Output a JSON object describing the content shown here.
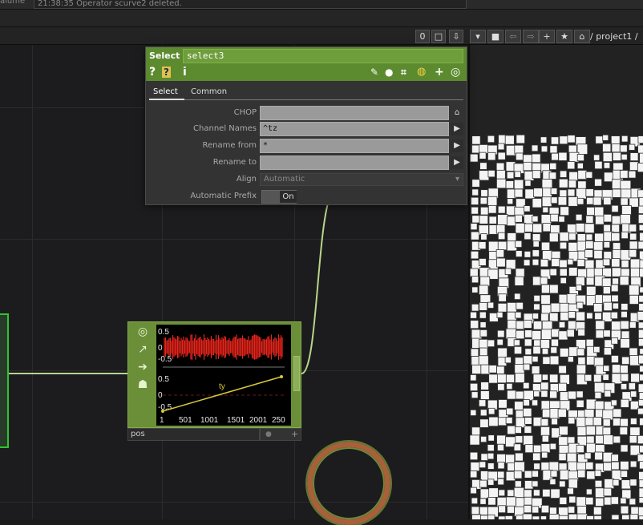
{
  "status_bar": {
    "label": "alume",
    "message": "21:38:35 Operator scurve2 deleted."
  },
  "toolbar": {
    "buttons": [
      "0",
      "□",
      "⇩",
      "▾",
      "■",
      "⇦",
      "⇨",
      "+",
      "★",
      "⌂"
    ],
    "path": "/ project1 /"
  },
  "parameter_panel": {
    "op_type": "Select",
    "op_name": "select3",
    "header_icons": [
      "help-icon",
      "python-help-icon",
      "info-icon",
      "edit-icon",
      "comment-icon",
      "clone-icon",
      "python-icon",
      "add-icon",
      "target-icon"
    ],
    "tabs": [
      {
        "label": "Select",
        "selected": true
      },
      {
        "label": "Common",
        "selected": false
      }
    ],
    "params": [
      {
        "label": "CHOP",
        "value": ""
      },
      {
        "label": "Channel Names",
        "value": "^tz"
      },
      {
        "label": "Rename from",
        "value": "*"
      },
      {
        "label": "Rename to",
        "value": ""
      },
      {
        "label": "Align",
        "value": "Automatic"
      },
      {
        "label": "Automatic Prefix",
        "value": "On"
      }
    ],
    "accent_color": "#5c8a2f"
  },
  "node_pos": {
    "name": "pos",
    "color": "#6a8f38",
    "flag_icons": [
      "viewer-icon",
      "bypass-icon",
      "display-icon",
      "lock-icon"
    ],
    "preview": {
      "top_ticks": [
        "0.5",
        "0",
        "-0.5"
      ],
      "bottom_ticks": [
        "0.5",
        "0",
        "-0.5"
      ],
      "x_ticks": [
        "1",
        "501",
        "1001",
        "1501",
        "2001",
        "250"
      ],
      "channel_label": "ty",
      "noise_color": "#e8251b",
      "line_color": "#d8c83a"
    }
  },
  "chart_data": {
    "type": "line",
    "series": [
      {
        "name": "ty",
        "x": [
          1,
          2500
        ],
        "y": [
          -0.5,
          0.5
        ]
      }
    ],
    "xlim": [
      1,
      2500
    ],
    "ylim": [
      -0.5,
      0.5
    ]
  }
}
